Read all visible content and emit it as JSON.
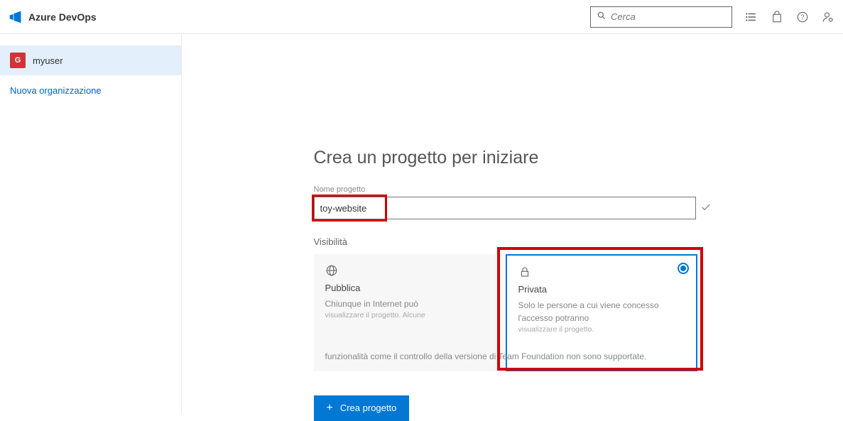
{
  "header": {
    "brand": "Azure DevOps",
    "search_placeholder": "Cerca"
  },
  "sidebar": {
    "org_initial": "G",
    "org_name": "myuser",
    "new_org_label": "Nuova organizzazione"
  },
  "form": {
    "title": "Crea un progetto per iniziare",
    "project_name_label": "Nome progetto",
    "project_name_value": "toy-website",
    "visibility_label": "Visibilità",
    "public": {
      "title": "Pubblica",
      "desc1": "Chiunque in Internet può",
      "desc2": "visualizzare il progetto. Alcune",
      "desc3": "funzionalità come il controllo della versione di Team Foundation non sono supportate."
    },
    "private": {
      "title": "Privata",
      "desc1": "Solo le persone a cui viene concesso l'accesso potranno",
      "desc2": "visualizzare il progetto."
    },
    "create_label": "Crea progetto"
  }
}
